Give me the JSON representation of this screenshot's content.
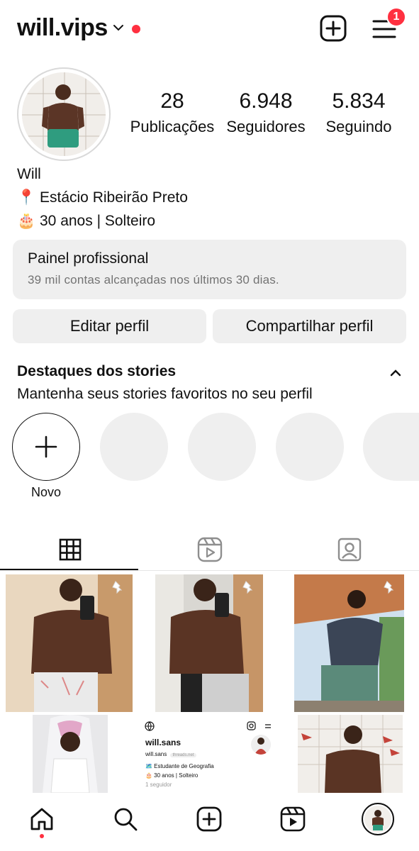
{
  "header": {
    "username": "will.vips",
    "notification_badge": "1"
  },
  "profile": {
    "stats": [
      {
        "value": "28",
        "label": "Publicações"
      },
      {
        "value": "6.948",
        "label": "Seguidores"
      },
      {
        "value": "5.834",
        "label": "Seguindo"
      }
    ],
    "name": "Will",
    "bio_lines": [
      {
        "emoji": "📍",
        "text": "Estácio Ribeirão Preto"
      },
      {
        "emoji": "🎂",
        "text": "30 anos | Solteiro"
      }
    ]
  },
  "pro_panel": {
    "title": "Painel profissional",
    "subtitle": "39 mil contas alcançadas nos últimos 30 dias."
  },
  "buttons": {
    "edit": "Editar perfil",
    "share": "Compartilhar perfil"
  },
  "highlights": {
    "title": "Destaques dos stories",
    "subtitle": "Mantenha seus stories favoritos no seu perfil",
    "new_label": "Novo"
  },
  "threads_card": {
    "name": "will.sans",
    "handle": "will.sans",
    "tag": "threads.net",
    "line1": "🗺️ Estudante de Geografia",
    "line2": "🎂 30 anos | Solteiro",
    "followers": "1 seguidor"
  },
  "colors": {
    "accent_red": "#ff3040",
    "panel_bg": "#efefef",
    "muted_text": "#737373"
  },
  "icons": [
    "chevron-down-icon",
    "new-post-icon",
    "menu-icon",
    "grid-icon",
    "reels-icon",
    "tagged-icon",
    "home-icon",
    "search-icon",
    "create-icon",
    "reels-nav-icon",
    "pin-icon"
  ]
}
